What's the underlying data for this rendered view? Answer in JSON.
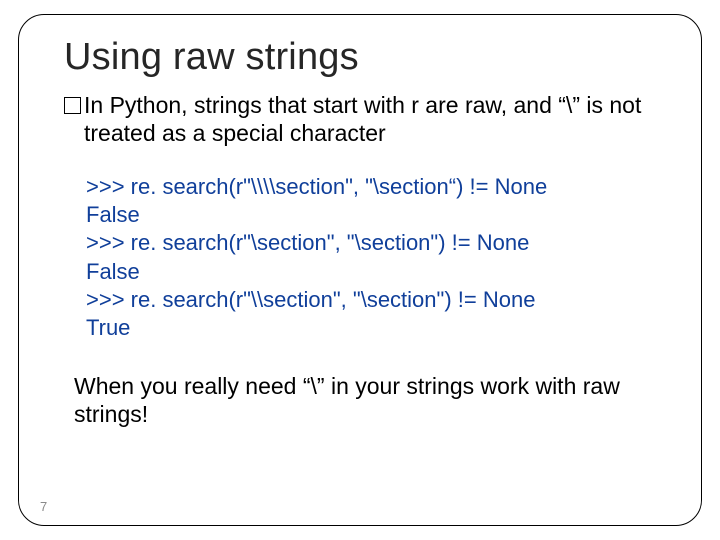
{
  "title": "Using raw strings",
  "bullet": {
    "text": "In Python, strings that start with r are raw, and “\\” is not treated as a special character"
  },
  "code": {
    "lines": [
      ">>> re. search(r\"\\\\\\\\section\", \"\\section“) != None",
      "False",
      ">>> re. search(r\"\\section\", \"\\section\") != None",
      "False",
      ">>> re. search(r\"\\\\section\", \"\\section\") != None",
      "True"
    ]
  },
  "closing": "When you really need “\\” in your strings work with raw strings!",
  "page": "7"
}
